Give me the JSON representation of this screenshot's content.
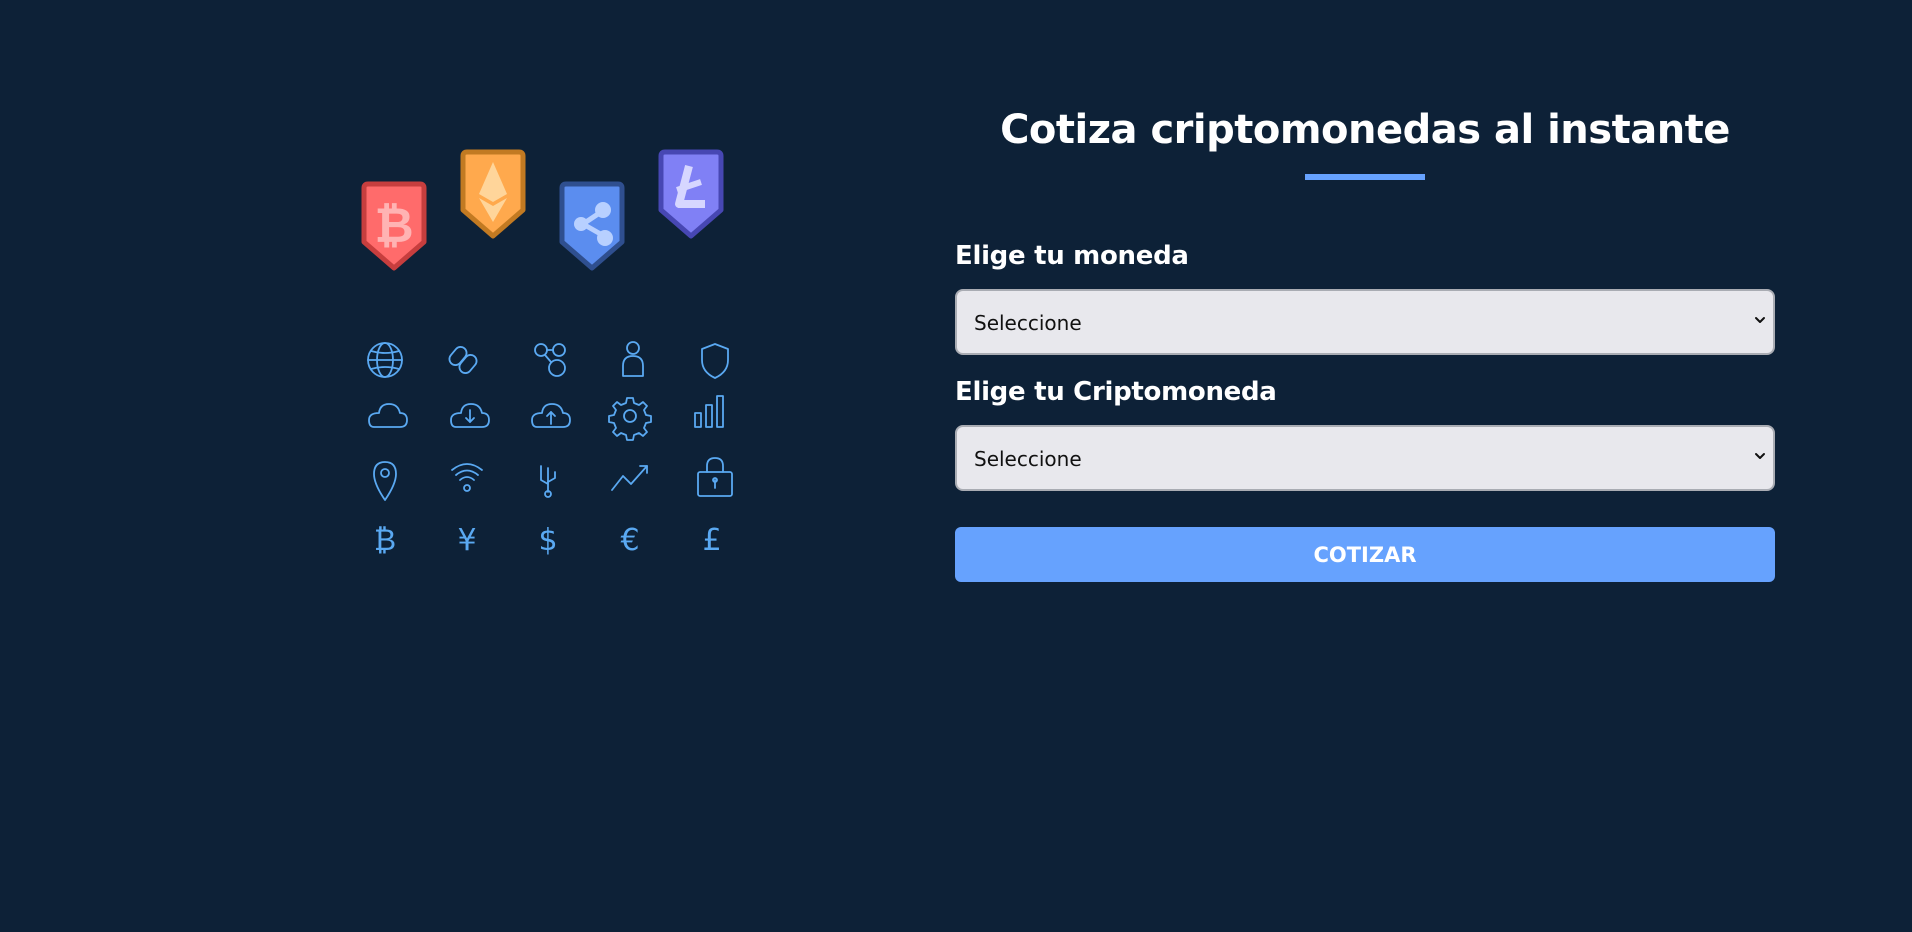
{
  "title": "Cotiza criptomonedas al instante",
  "colors": {
    "background": "#0d2137",
    "accent": "#66a2fe",
    "select_background": "#e8e8ed",
    "icon_stroke": "#5aa9f2",
    "bitcoin_badge": "#ff6b6b",
    "ethereum_badge": "#ffa64d",
    "ripple_badge": "#5b8def",
    "litecoin_badge": "#7b7bf2"
  },
  "illustration": {
    "badges": [
      "bitcoin-icon",
      "ethereum-icon",
      "ripple-icon",
      "litecoin-icon"
    ],
    "icon_rows": [
      [
        "globe-icon",
        "chain-link-icon",
        "network-nodes-icon",
        "user-icon",
        "shield-icon"
      ],
      [
        "cloud-icon",
        "cloud-download-icon",
        "cloud-upload-icon",
        "gear-icon",
        "bar-chart-icon"
      ],
      [
        "location-pin-icon",
        "wifi-icon",
        "usb-icon",
        "trend-up-icon",
        "padlock-icon"
      ],
      [
        "bitcoin-sign-icon",
        "yen-sign-icon",
        "dollar-sign-icon",
        "euro-sign-icon",
        "pound-sign-icon"
      ]
    ]
  },
  "form": {
    "currency": {
      "label": "Elige tu moneda",
      "selected": "Seleccione"
    },
    "crypto": {
      "label": "Elige tu Criptomoneda",
      "selected": "Seleccione"
    },
    "submit_label": "Cotizar"
  }
}
